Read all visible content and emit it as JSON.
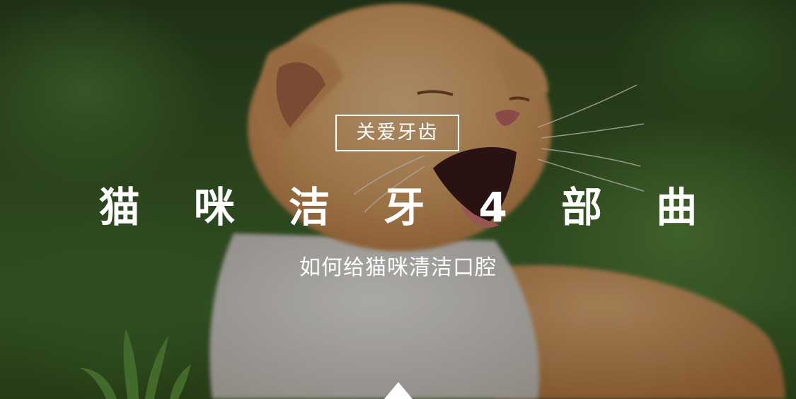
{
  "hero": {
    "badge": "关爱牙齿",
    "title": "猫 咪 洁 牙 4 部 曲",
    "subtitle": "如何给猫咪清洁口腔"
  },
  "colors": {
    "text": "#ffffff",
    "overlay": "rgba(0,0,0,0.30)",
    "grass": "#466f31",
    "kitten_fur": "#e8b57a",
    "kitten_chest": "#e9e6e0"
  },
  "icons": {
    "scroll": "up-triangle-icon"
  }
}
